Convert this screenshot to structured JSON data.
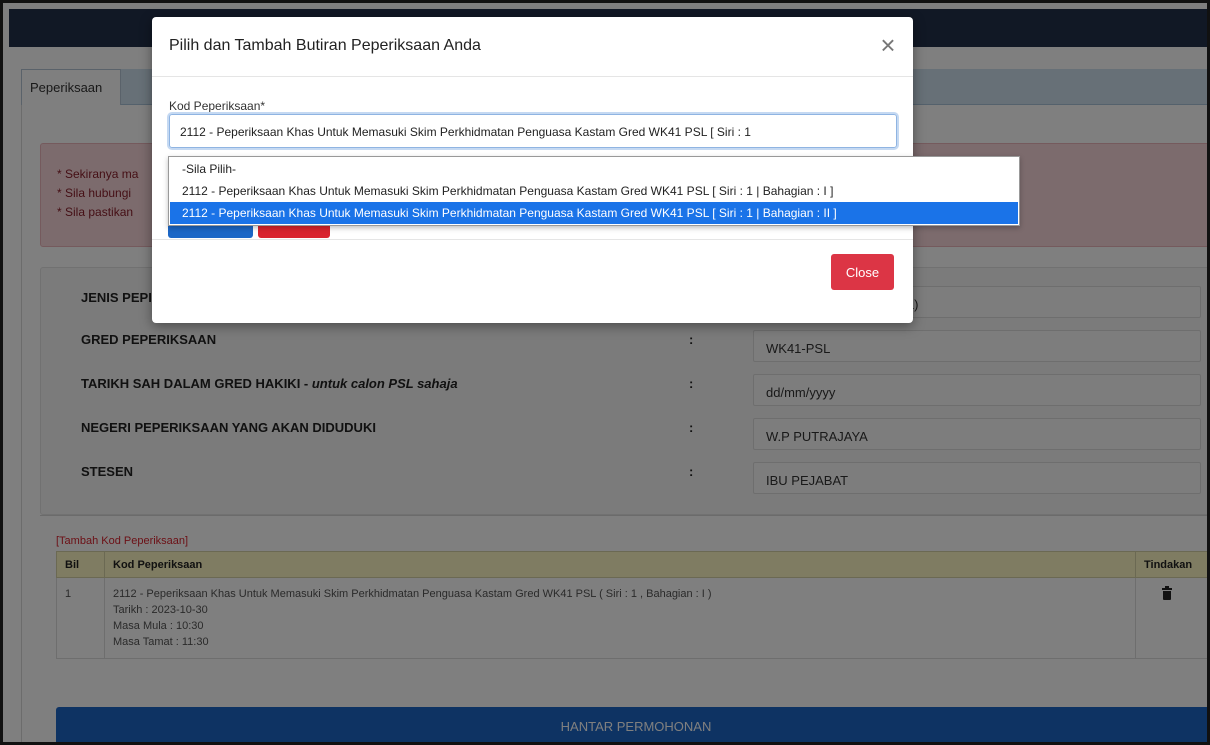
{
  "tabs": [
    {
      "label": "Peperiksaan"
    }
  ],
  "alert": {
    "lines": [
      "* Sekiranya ma",
      "* Sila hubungi",
      "* Sila pastikan"
    ]
  },
  "details": [
    {
      "label": "JENIS PEPI",
      "label_em": "",
      "value": "tan Secara Lantikan (PSL)"
    },
    {
      "label": "GRED PEPERIKSAAN",
      "label_em": "",
      "value": "WK41-PSL"
    },
    {
      "label": "TARIKH SAH DALAM GRED HAKIKI - ",
      "label_em": "untuk calon PSL sahaja",
      "value": "dd/mm/yyyy"
    },
    {
      "label": "NEGERI PEPERIKSAAN YANG AKAN DIDUDUKI",
      "label_em": "",
      "value": "W.P PUTRAJAYA"
    },
    {
      "label": "STESEN",
      "label_em": "",
      "value": "IBU PEJABAT"
    }
  ],
  "colon": ":",
  "add_link": "[Tambah Kod Peperiksaan]",
  "table": {
    "headers": {
      "bil": "Bil",
      "kod": "Kod Peperiksaan",
      "tindakan": "Tindakan"
    },
    "rows": [
      {
        "bil": "1",
        "line1": "2112 - Peperiksaan Khas Untuk Memasuki Skim Perkhidmatan Penguasa Kastam Gred WK41 PSL ( Siri : 1 , Bahagian : I )",
        "line2": "Tarikh : 2023-10-30",
        "line3": "Masa Mula : 10:30",
        "line4": "Masa Tamat : 11:30"
      }
    ]
  },
  "submit_label": "HANTAR PERMOHONAN",
  "modal": {
    "title": "Pilih dan Tambah Butiran Peperiksaan Anda",
    "close_symbol": "×",
    "field_label": "Kod Peperiksaan*",
    "selected_value": "2112 - Peperiksaan Khas Untuk Memasuki Skim Perkhidmatan Penguasa Kastam Gred WK41 PSL   [ Siri : 1",
    "options": [
      "-Sila Pilih-",
      "2112 - Peperiksaan Khas Untuk Memasuki Skim Perkhidmatan Penguasa Kastam Gred WK41 PSL   [ Siri : 1 | Bahagian : I ]",
      "2112 - Peperiksaan Khas Untuk Memasuki Skim Perkhidmatan Penguasa Kastam Gred WK41 PSL   [ Siri : 1 | Bahagian : II ]"
    ],
    "close_button": "Close"
  },
  "colors": {
    "accent": "#1c67c6",
    "danger": "#dc3545",
    "selected_option": "#1a73e8"
  },
  "icons": [
    "close-icon",
    "trash-icon"
  ]
}
